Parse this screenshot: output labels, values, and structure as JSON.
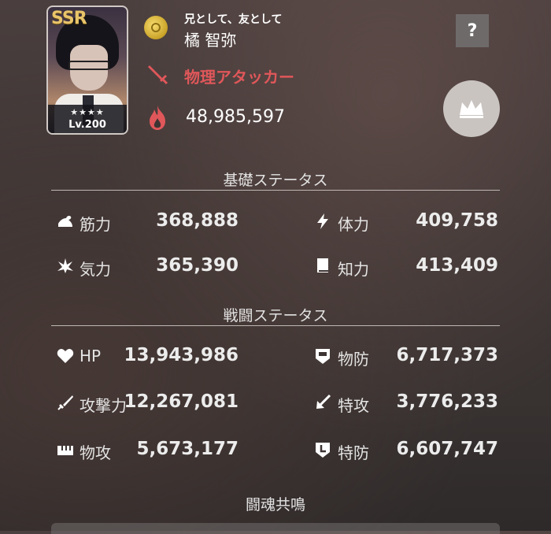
{
  "character": {
    "rarity": "SSR",
    "stars": "★★★★",
    "level": "Lv.200",
    "subtitle": "兄として、友として",
    "name": "橘 智弥",
    "class": "物理アタッカー",
    "power": "48,985,597"
  },
  "buttons": {
    "help": "?"
  },
  "basic_section": {
    "title": "基礎ステータス",
    "stats": [
      {
        "label": "筋力",
        "value": "368,888",
        "icon": "arm-strength-icon"
      },
      {
        "label": "体力",
        "value": "409,758",
        "icon": "lightning-icon"
      },
      {
        "label": "気力",
        "value": "365,390",
        "icon": "spirit-burst-icon"
      },
      {
        "label": "知力",
        "value": "413,409",
        "icon": "book-icon"
      }
    ]
  },
  "battle_section": {
    "title": "戦闘ステータス",
    "stats": [
      {
        "label": "HP",
        "value": "13,943,986",
        "icon": "heart-icon"
      },
      {
        "label": "物防",
        "value": "6,717,373",
        "icon": "shield-icon"
      },
      {
        "label": "攻撃力",
        "value": "12,267,081",
        "icon": "sword-icon"
      },
      {
        "label": "特攻",
        "value": "3,776,233",
        "icon": "arrow-icon"
      },
      {
        "label": "物攻",
        "value": "5,673,177",
        "icon": "fist-icon"
      },
      {
        "label": "特防",
        "value": "6,607,747",
        "icon": "special-shield-icon"
      }
    ]
  },
  "resonance_section": {
    "title": "闘魂共鳴"
  },
  "colors": {
    "class_red": "#e0575a",
    "coin_gold": "#c9a227",
    "rarity_gold": "#e8c46a"
  }
}
